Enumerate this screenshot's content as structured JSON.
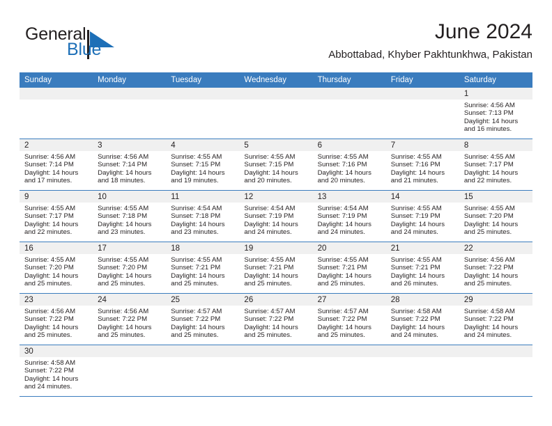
{
  "brand": {
    "name_part1": "General",
    "name_part2": "Blue",
    "logo_icon": "triangle-logo-icon",
    "accent_color": "#1d6fb7"
  },
  "header": {
    "title": "June 2024",
    "subtitle": "Abbottabad, Khyber Pakhtunkhwa, Pakistan"
  },
  "theme": {
    "header_row_bg": "#3a7cbe",
    "daynum_band_bg": "#f0f0f0",
    "grid_line": "#3a7cbe",
    "text": "#231f20"
  },
  "weekdays": [
    "Sunday",
    "Monday",
    "Tuesday",
    "Wednesday",
    "Thursday",
    "Friday",
    "Saturday"
  ],
  "weeks": [
    [
      {
        "day": "",
        "sunrise": "",
        "sunset": "",
        "daylight_line1": "",
        "daylight_line2": "",
        "empty": true
      },
      {
        "day": "",
        "sunrise": "",
        "sunset": "",
        "daylight_line1": "",
        "daylight_line2": "",
        "empty": true
      },
      {
        "day": "",
        "sunrise": "",
        "sunset": "",
        "daylight_line1": "",
        "daylight_line2": "",
        "empty": true
      },
      {
        "day": "",
        "sunrise": "",
        "sunset": "",
        "daylight_line1": "",
        "daylight_line2": "",
        "empty": true
      },
      {
        "day": "",
        "sunrise": "",
        "sunset": "",
        "daylight_line1": "",
        "daylight_line2": "",
        "empty": true
      },
      {
        "day": "",
        "sunrise": "",
        "sunset": "",
        "daylight_line1": "",
        "daylight_line2": "",
        "empty": true
      },
      {
        "day": "1",
        "sunrise": "Sunrise: 4:56 AM",
        "sunset": "Sunset: 7:13 PM",
        "daylight_line1": "Daylight: 14 hours",
        "daylight_line2": "and 16 minutes.",
        "empty": false
      }
    ],
    [
      {
        "day": "2",
        "sunrise": "Sunrise: 4:56 AM",
        "sunset": "Sunset: 7:14 PM",
        "daylight_line1": "Daylight: 14 hours",
        "daylight_line2": "and 17 minutes.",
        "empty": false
      },
      {
        "day": "3",
        "sunrise": "Sunrise: 4:56 AM",
        "sunset": "Sunset: 7:14 PM",
        "daylight_line1": "Daylight: 14 hours",
        "daylight_line2": "and 18 minutes.",
        "empty": false
      },
      {
        "day": "4",
        "sunrise": "Sunrise: 4:55 AM",
        "sunset": "Sunset: 7:15 PM",
        "daylight_line1": "Daylight: 14 hours",
        "daylight_line2": "and 19 minutes.",
        "empty": false
      },
      {
        "day": "5",
        "sunrise": "Sunrise: 4:55 AM",
        "sunset": "Sunset: 7:15 PM",
        "daylight_line1": "Daylight: 14 hours",
        "daylight_line2": "and 20 minutes.",
        "empty": false
      },
      {
        "day": "6",
        "sunrise": "Sunrise: 4:55 AM",
        "sunset": "Sunset: 7:16 PM",
        "daylight_line1": "Daylight: 14 hours",
        "daylight_line2": "and 20 minutes.",
        "empty": false
      },
      {
        "day": "7",
        "sunrise": "Sunrise: 4:55 AM",
        "sunset": "Sunset: 7:16 PM",
        "daylight_line1": "Daylight: 14 hours",
        "daylight_line2": "and 21 minutes.",
        "empty": false
      },
      {
        "day": "8",
        "sunrise": "Sunrise: 4:55 AM",
        "sunset": "Sunset: 7:17 PM",
        "daylight_line1": "Daylight: 14 hours",
        "daylight_line2": "and 22 minutes.",
        "empty": false
      }
    ],
    [
      {
        "day": "9",
        "sunrise": "Sunrise: 4:55 AM",
        "sunset": "Sunset: 7:17 PM",
        "daylight_line1": "Daylight: 14 hours",
        "daylight_line2": "and 22 minutes.",
        "empty": false
      },
      {
        "day": "10",
        "sunrise": "Sunrise: 4:55 AM",
        "sunset": "Sunset: 7:18 PM",
        "daylight_line1": "Daylight: 14 hours",
        "daylight_line2": "and 23 minutes.",
        "empty": false
      },
      {
        "day": "11",
        "sunrise": "Sunrise: 4:54 AM",
        "sunset": "Sunset: 7:18 PM",
        "daylight_line1": "Daylight: 14 hours",
        "daylight_line2": "and 23 minutes.",
        "empty": false
      },
      {
        "day": "12",
        "sunrise": "Sunrise: 4:54 AM",
        "sunset": "Sunset: 7:19 PM",
        "daylight_line1": "Daylight: 14 hours",
        "daylight_line2": "and 24 minutes.",
        "empty": false
      },
      {
        "day": "13",
        "sunrise": "Sunrise: 4:54 AM",
        "sunset": "Sunset: 7:19 PM",
        "daylight_line1": "Daylight: 14 hours",
        "daylight_line2": "and 24 minutes.",
        "empty": false
      },
      {
        "day": "14",
        "sunrise": "Sunrise: 4:55 AM",
        "sunset": "Sunset: 7:19 PM",
        "daylight_line1": "Daylight: 14 hours",
        "daylight_line2": "and 24 minutes.",
        "empty": false
      },
      {
        "day": "15",
        "sunrise": "Sunrise: 4:55 AM",
        "sunset": "Sunset: 7:20 PM",
        "daylight_line1": "Daylight: 14 hours",
        "daylight_line2": "and 25 minutes.",
        "empty": false
      }
    ],
    [
      {
        "day": "16",
        "sunrise": "Sunrise: 4:55 AM",
        "sunset": "Sunset: 7:20 PM",
        "daylight_line1": "Daylight: 14 hours",
        "daylight_line2": "and 25 minutes.",
        "empty": false
      },
      {
        "day": "17",
        "sunrise": "Sunrise: 4:55 AM",
        "sunset": "Sunset: 7:20 PM",
        "daylight_line1": "Daylight: 14 hours",
        "daylight_line2": "and 25 minutes.",
        "empty": false
      },
      {
        "day": "18",
        "sunrise": "Sunrise: 4:55 AM",
        "sunset": "Sunset: 7:21 PM",
        "daylight_line1": "Daylight: 14 hours",
        "daylight_line2": "and 25 minutes.",
        "empty": false
      },
      {
        "day": "19",
        "sunrise": "Sunrise: 4:55 AM",
        "sunset": "Sunset: 7:21 PM",
        "daylight_line1": "Daylight: 14 hours",
        "daylight_line2": "and 25 minutes.",
        "empty": false
      },
      {
        "day": "20",
        "sunrise": "Sunrise: 4:55 AM",
        "sunset": "Sunset: 7:21 PM",
        "daylight_line1": "Daylight: 14 hours",
        "daylight_line2": "and 25 minutes.",
        "empty": false
      },
      {
        "day": "21",
        "sunrise": "Sunrise: 4:55 AM",
        "sunset": "Sunset: 7:21 PM",
        "daylight_line1": "Daylight: 14 hours",
        "daylight_line2": "and 26 minutes.",
        "empty": false
      },
      {
        "day": "22",
        "sunrise": "Sunrise: 4:56 AM",
        "sunset": "Sunset: 7:22 PM",
        "daylight_line1": "Daylight: 14 hours",
        "daylight_line2": "and 25 minutes.",
        "empty": false
      }
    ],
    [
      {
        "day": "23",
        "sunrise": "Sunrise: 4:56 AM",
        "sunset": "Sunset: 7:22 PM",
        "daylight_line1": "Daylight: 14 hours",
        "daylight_line2": "and 25 minutes.",
        "empty": false
      },
      {
        "day": "24",
        "sunrise": "Sunrise: 4:56 AM",
        "sunset": "Sunset: 7:22 PM",
        "daylight_line1": "Daylight: 14 hours",
        "daylight_line2": "and 25 minutes.",
        "empty": false
      },
      {
        "day": "25",
        "sunrise": "Sunrise: 4:57 AM",
        "sunset": "Sunset: 7:22 PM",
        "daylight_line1": "Daylight: 14 hours",
        "daylight_line2": "and 25 minutes.",
        "empty": false
      },
      {
        "day": "26",
        "sunrise": "Sunrise: 4:57 AM",
        "sunset": "Sunset: 7:22 PM",
        "daylight_line1": "Daylight: 14 hours",
        "daylight_line2": "and 25 minutes.",
        "empty": false
      },
      {
        "day": "27",
        "sunrise": "Sunrise: 4:57 AM",
        "sunset": "Sunset: 7:22 PM",
        "daylight_line1": "Daylight: 14 hours",
        "daylight_line2": "and 25 minutes.",
        "empty": false
      },
      {
        "day": "28",
        "sunrise": "Sunrise: 4:58 AM",
        "sunset": "Sunset: 7:22 PM",
        "daylight_line1": "Daylight: 14 hours",
        "daylight_line2": "and 24 minutes.",
        "empty": false
      },
      {
        "day": "29",
        "sunrise": "Sunrise: 4:58 AM",
        "sunset": "Sunset: 7:22 PM",
        "daylight_line1": "Daylight: 14 hours",
        "daylight_line2": "and 24 minutes.",
        "empty": false
      }
    ],
    [
      {
        "day": "30",
        "sunrise": "Sunrise: 4:58 AM",
        "sunset": "Sunset: 7:22 PM",
        "daylight_line1": "Daylight: 14 hours",
        "daylight_line2": "and 24 minutes.",
        "empty": false
      },
      {
        "day": "",
        "sunrise": "",
        "sunset": "",
        "daylight_line1": "",
        "daylight_line2": "",
        "empty": true
      },
      {
        "day": "",
        "sunrise": "",
        "sunset": "",
        "daylight_line1": "",
        "daylight_line2": "",
        "empty": true
      },
      {
        "day": "",
        "sunrise": "",
        "sunset": "",
        "daylight_line1": "",
        "daylight_line2": "",
        "empty": true
      },
      {
        "day": "",
        "sunrise": "",
        "sunset": "",
        "daylight_line1": "",
        "daylight_line2": "",
        "empty": true
      },
      {
        "day": "",
        "sunrise": "",
        "sunset": "",
        "daylight_line1": "",
        "daylight_line2": "",
        "empty": true
      },
      {
        "day": "",
        "sunrise": "",
        "sunset": "",
        "daylight_line1": "",
        "daylight_line2": "",
        "empty": true
      }
    ]
  ]
}
